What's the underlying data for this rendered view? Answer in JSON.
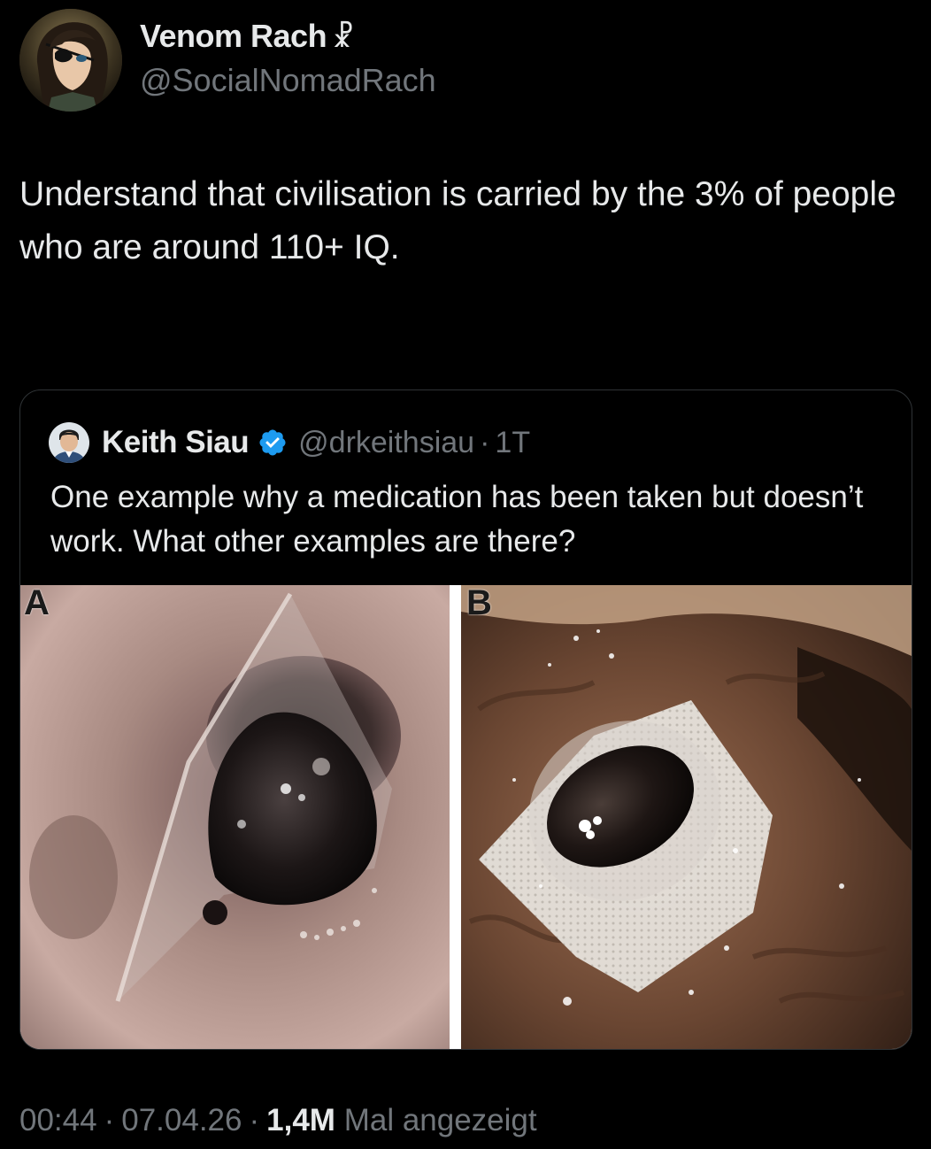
{
  "author": {
    "display_name": "Venom Rach",
    "name_symbol": "☧",
    "handle": "@SocialNomadRach",
    "avatar_icon": "anime-avatar-eyepatch"
  },
  "tweet": {
    "text": "Understand that civilisation is carried by the 3% of people who are around 110+ IQ."
  },
  "quoted_tweet": {
    "display_name": "Keith Siau",
    "verified_icon": "verified-badge-icon",
    "verified_color": "#1d9bf0",
    "handle": "@drkeithsiau",
    "separator": "·",
    "time": "1T",
    "text": "One example why a medication has been taken but doesn’t work. What other examples are there?",
    "media": {
      "panel_a_label": "A",
      "panel_b_label": "B"
    }
  },
  "meta": {
    "time": "00:44",
    "separator": "·",
    "date": "07.04.26",
    "views": "1,4M",
    "views_label": "Mal angezeigt"
  },
  "colors": {
    "background": "#000000",
    "primary_text": "#e7e9ea",
    "secondary_text": "#71767b",
    "border": "#2f3336"
  }
}
